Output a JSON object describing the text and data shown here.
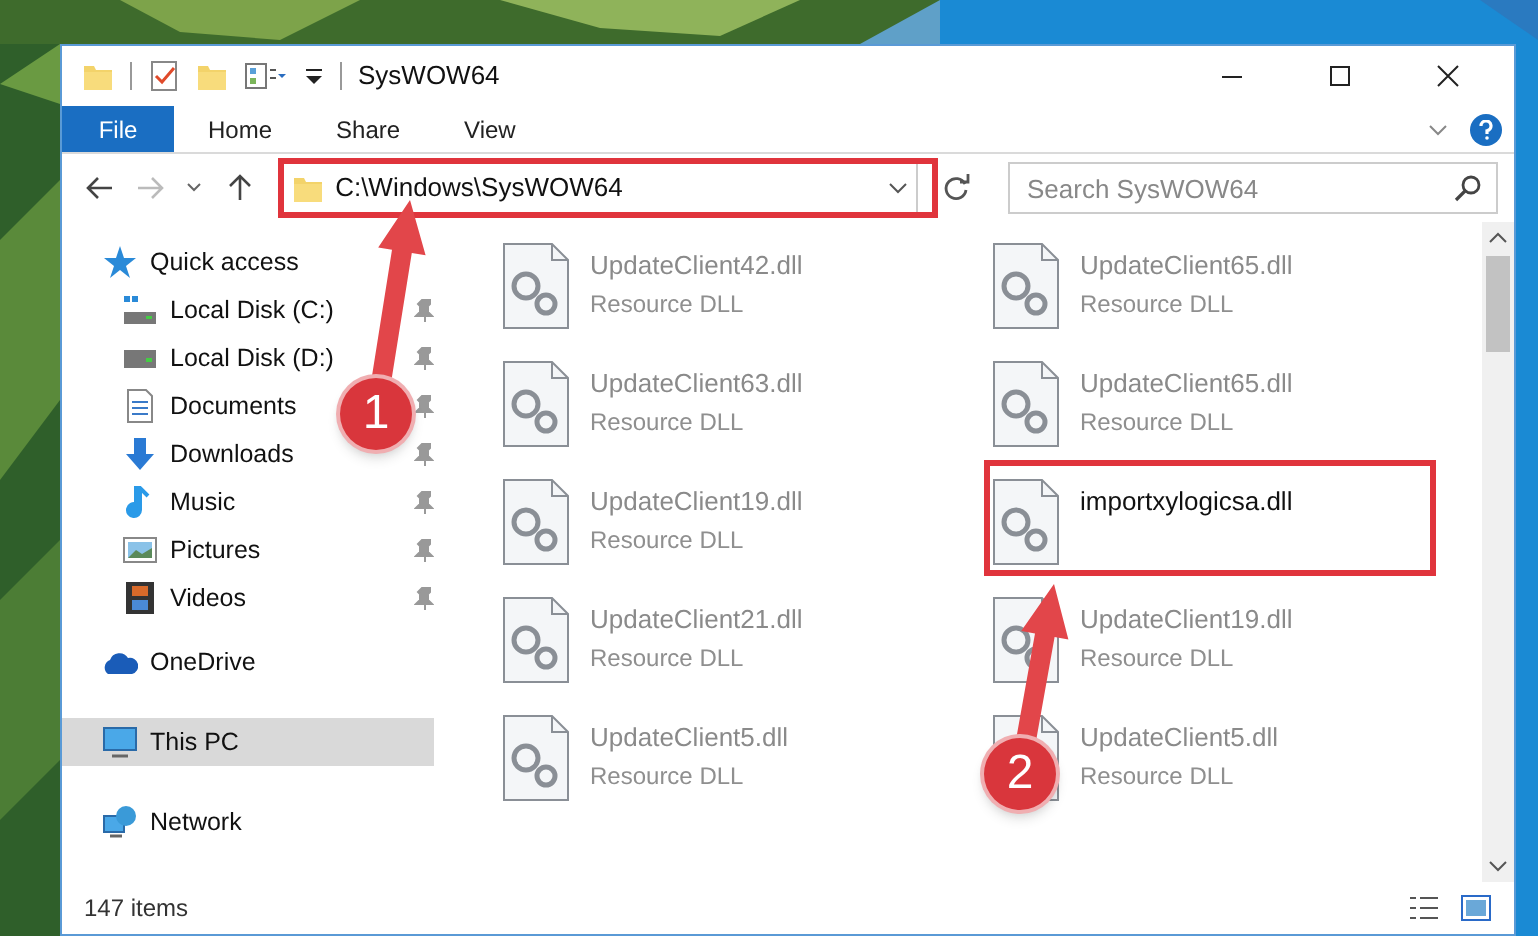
{
  "window": {
    "title": "SysWOW64"
  },
  "ribbon_tabs": [
    {
      "label": "File",
      "kind": "file"
    },
    {
      "label": "Home",
      "kind": "tab"
    },
    {
      "label": "Share",
      "kind": "tab"
    },
    {
      "label": "View",
      "kind": "tab"
    }
  ],
  "address_bar": {
    "path": "C:\\Windows\\SysWOW64",
    "highlighted": true
  },
  "search": {
    "placeholder": "Search SysWOW64"
  },
  "navigation": [
    {
      "label": "Quick access",
      "kind": "star",
      "selected": false,
      "children": [
        {
          "label": "Local Disk (C:)",
          "kind": "system-drive",
          "pinned": true,
          "selected": false
        },
        {
          "label": "Local Disk (D:)",
          "kind": "drive",
          "pinned": true,
          "selected": false
        },
        {
          "label": "Documents",
          "kind": "documents",
          "pinned": true,
          "selected": false
        },
        {
          "label": "Downloads",
          "kind": "downloads",
          "pinned": true,
          "selected": false
        },
        {
          "label": "Music",
          "kind": "music",
          "pinned": true,
          "selected": false
        },
        {
          "label": "Pictures",
          "kind": "pictures",
          "pinned": true,
          "selected": false
        },
        {
          "label": "Videos",
          "kind": "videos",
          "pinned": true,
          "selected": false
        }
      ]
    },
    {
      "label": "OneDrive",
      "kind": "cloud",
      "selected": false
    },
    {
      "label": "This PC",
      "kind": "pc",
      "selected": true
    },
    {
      "label": "Network",
      "kind": "network",
      "selected": false
    }
  ],
  "files": [
    {
      "name": "UpdateClient42.dll",
      "type": "Resource DLL",
      "blurred": true,
      "highlighted": false
    },
    {
      "name": "UpdateClient65.dll",
      "type": "Resource DLL",
      "blurred": true,
      "highlighted": false
    },
    {
      "name": "UpdateClient63.dll",
      "type": "Resource DLL",
      "blurred": true,
      "highlighted": false
    },
    {
      "name": "UpdateClient65.dll",
      "type": "Resource DLL",
      "blurred": true,
      "highlighted": false
    },
    {
      "name": "UpdateClient19.dll",
      "type": "Resource DLL",
      "blurred": true,
      "highlighted": false
    },
    {
      "name": "importxylogicsa.dll",
      "blurred": false,
      "highlighted": true
    },
    {
      "name": "UpdateClient21.dll",
      "type": "Resource DLL",
      "blurred": true,
      "highlighted": false
    },
    {
      "name": "UpdateClient19.dll",
      "type": "Resource DLL",
      "blurred": true,
      "highlighted": false
    },
    {
      "name": "UpdateClient5.dll",
      "type": "Resource DLL",
      "blurred": true,
      "highlighted": false
    },
    {
      "name": "UpdateClient5.dll",
      "type": "Resource DLL",
      "blurred": true,
      "highlighted": false
    }
  ],
  "status_bar": {
    "item_count": "147 items"
  },
  "annotations": [
    {
      "number": "1"
    },
    {
      "number": "2"
    }
  ]
}
